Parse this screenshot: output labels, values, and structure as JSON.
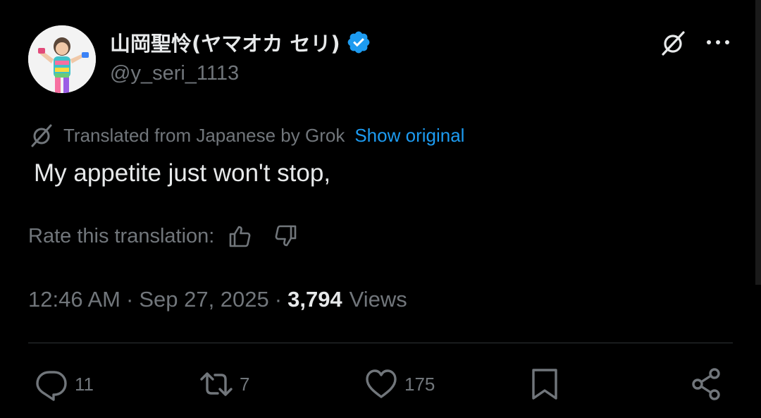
{
  "tweet": {
    "display_name": "山岡聖怜(ヤマオカ セリ)",
    "handle": "@y_seri_1113",
    "translated_label": "Translated from Japanese by Grok",
    "show_original_label": "Show original",
    "text": "My appetite just won't stop,",
    "rate_label": "Rate this translation:",
    "time": "12:46 AM",
    "separator": "·",
    "date": "Sep 27, 2025",
    "views_count": "3,794",
    "views_label": "Views"
  },
  "actions": {
    "replies": "11",
    "reposts": "7",
    "likes": "175"
  },
  "colors": {
    "background": "#000000",
    "text_primary": "#e7e9ea",
    "text_secondary": "#71767b",
    "link": "#1d9bf0",
    "verified": "#1d9bf0",
    "divider": "#2f3336"
  },
  "icons": [
    "verified-badge-icon",
    "grok-icon",
    "more-icon",
    "thumbs-up-icon",
    "thumbs-down-icon",
    "reply-icon",
    "repost-icon",
    "like-icon",
    "bookmark-icon",
    "share-icon"
  ]
}
